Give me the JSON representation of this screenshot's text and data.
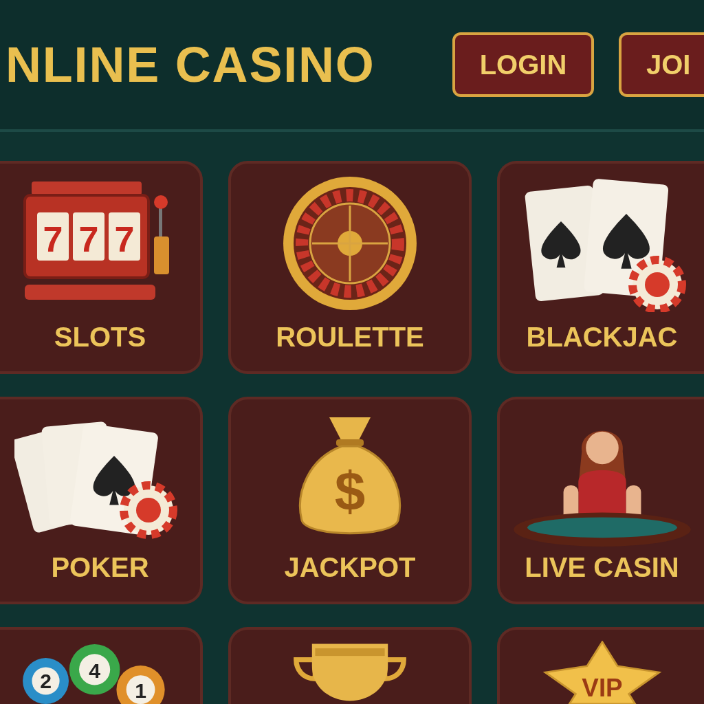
{
  "header": {
    "title": "NLINE CASINO",
    "buttons": [
      {
        "label": "LOGIN"
      },
      {
        "label": "JOI"
      }
    ]
  },
  "games": [
    {
      "kind": "slots",
      "label": "SLOTS",
      "reels": [
        "7",
        "7",
        "7"
      ]
    },
    {
      "kind": "roulette",
      "label": "ROULETTE"
    },
    {
      "kind": "blackjack",
      "label": "BLACKJAC"
    },
    {
      "kind": "poker",
      "label": "POKER"
    },
    {
      "kind": "jackpot",
      "label": "JACKPOT",
      "symbol": "$"
    },
    {
      "kind": "live",
      "label": "LIVE CASIN"
    },
    {
      "kind": "lottery",
      "balls": [
        "2",
        "4",
        "1"
      ]
    },
    {
      "kind": "trophy"
    },
    {
      "kind": "vip",
      "badge": "VIP"
    }
  ]
}
